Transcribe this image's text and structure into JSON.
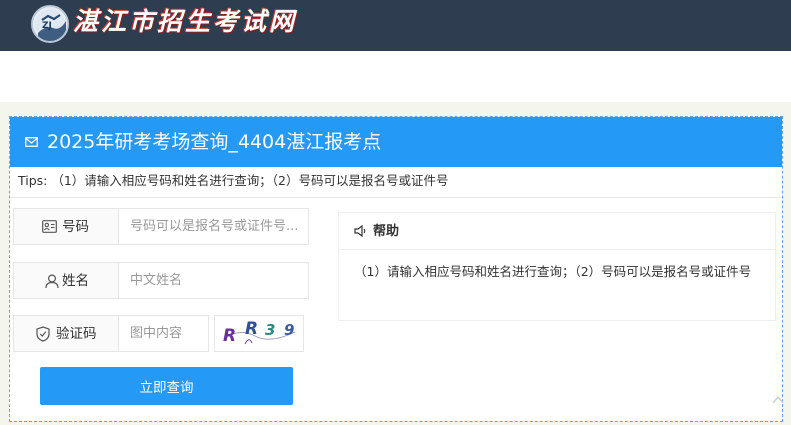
{
  "header": {
    "site_name": "湛江市招生考试网",
    "emblem_icon": "school-emblem-icon"
  },
  "panel": {
    "title": "2025年研考考场查询_4404湛江报考点",
    "title_icon": "mail-icon",
    "tips": "Tips: （1）请输入相应号码和姓名进行查询；（2）号码可以是报名号或证件号"
  },
  "form": {
    "number_label": "号码",
    "number_icon": "id-card-icon",
    "number_placeholder": "号码可以是报名号或证件号...",
    "name_label": "姓名",
    "name_icon": "user-icon",
    "name_placeholder": "中文姓名",
    "captcha_label": "验证码",
    "captcha_icon": "shield-check-icon",
    "captcha_placeholder": "图中内容",
    "captcha_chars": [
      "R",
      "R",
      "3",
      "9"
    ],
    "submit_label": "立即查询"
  },
  "help": {
    "title": "帮助",
    "icon": "speaker-icon",
    "body": "（1）请输入相应号码和姓名进行查询；（2）号码可以是报名号或证件号"
  },
  "colors": {
    "header_bg": "#2e3d4f",
    "accent": "#2499f5",
    "page_bg": "#f4f6ee"
  }
}
